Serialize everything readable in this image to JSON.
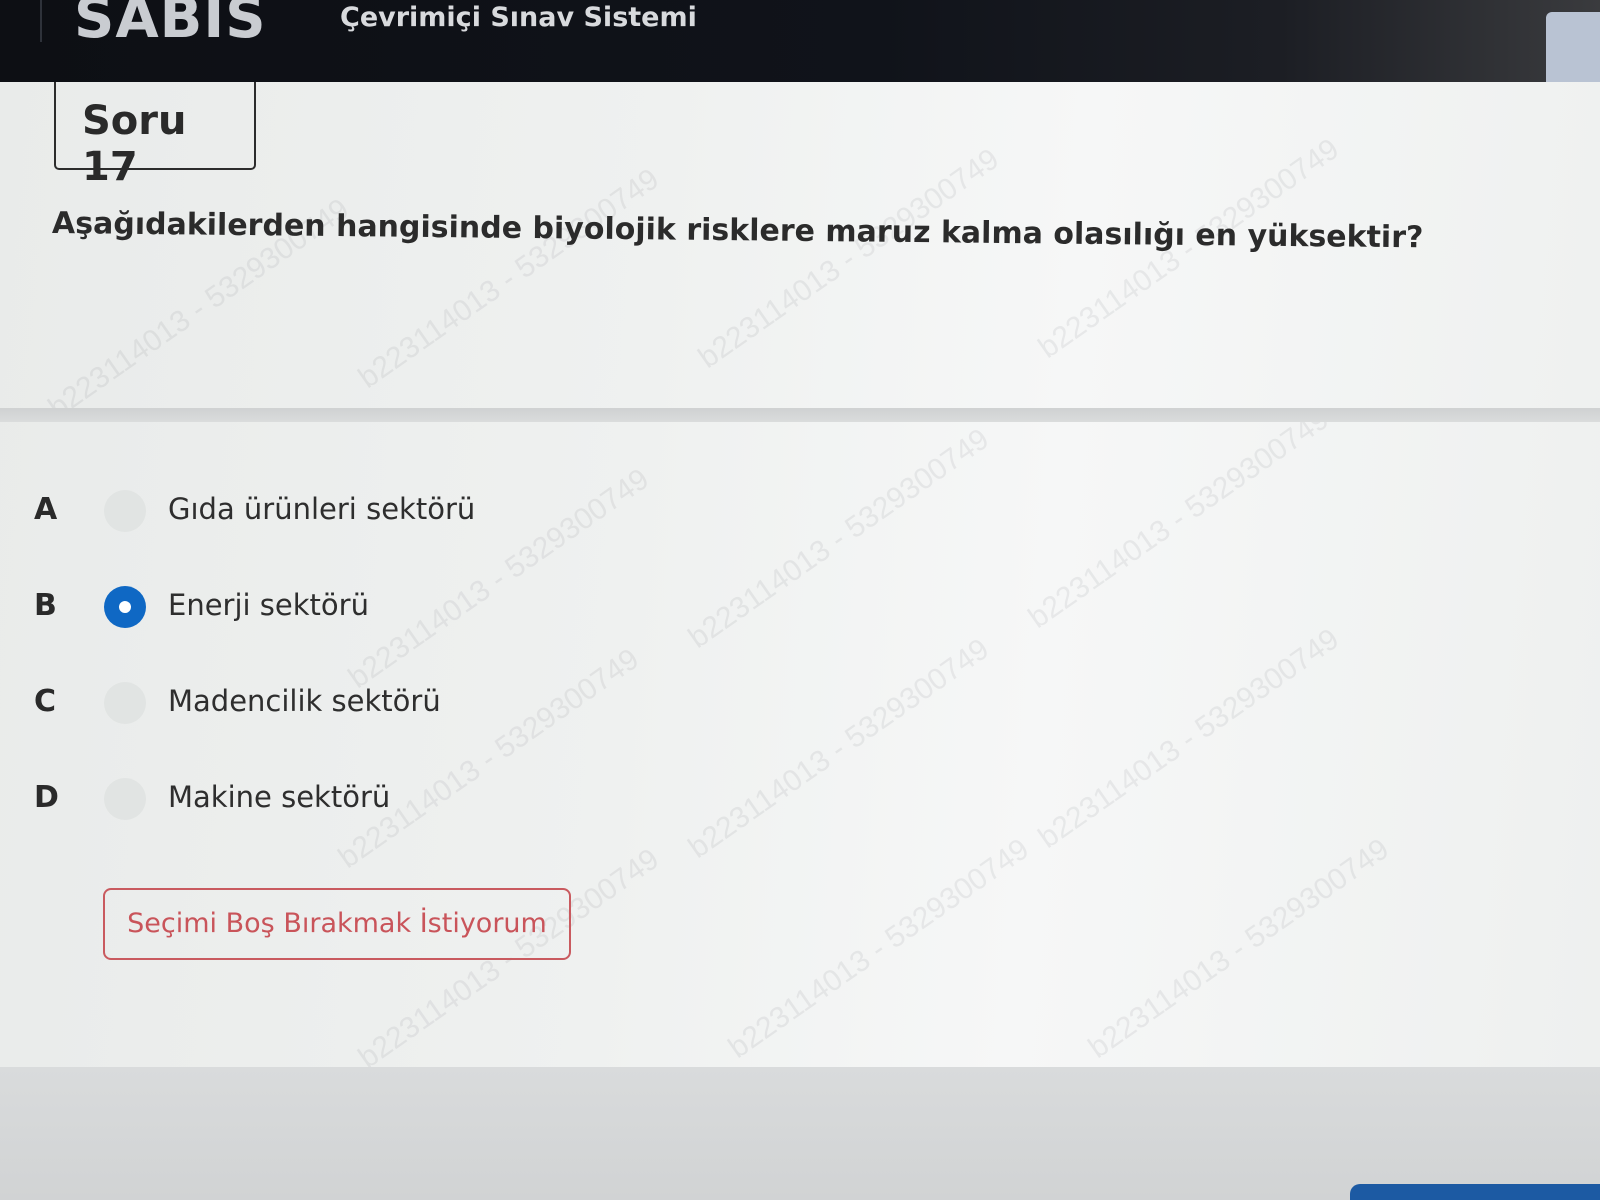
{
  "header": {
    "logo": "SABİS",
    "app_title": "Çevrimiçi Sınav Sistemi"
  },
  "question": {
    "label": "Soru 17",
    "text": "Aşağıdakilerden hangisinde biyolojik risklere maruz kalma olasılığı en yüksektir?"
  },
  "options": [
    {
      "letter": "A",
      "text": "Gıda ürünleri sektörü",
      "selected": false
    },
    {
      "letter": "B",
      "text": "Enerji sektörü",
      "selected": true
    },
    {
      "letter": "C",
      "text": "Madencilik sektörü",
      "selected": false
    },
    {
      "letter": "D",
      "text": "Makine sektörü",
      "selected": false
    }
  ],
  "skip_button": "Seçimi Boş Bırakmak İstiyorum",
  "watermark": "b223114013 - 5329300749",
  "colors": {
    "header_bg": "#10131a",
    "radio_selected": "#0f68c4",
    "skip_button_border": "#c95a5f",
    "text": "#2b2b2b"
  }
}
